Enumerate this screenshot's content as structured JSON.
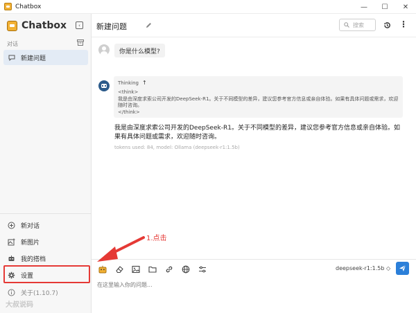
{
  "window": {
    "title": "Chatbox",
    "controls": [
      "—",
      "☐",
      "✕"
    ]
  },
  "sidebar": {
    "brand": "Chatbox",
    "section_label": "对话",
    "conversations": [
      {
        "label": "新建问题"
      }
    ],
    "menu": {
      "new_chat": "新对话",
      "new_image": "新图片",
      "my_partners": "我的搭档",
      "settings": "设置",
      "about": "关于(1.10.7)"
    },
    "watermark": "大叔说码"
  },
  "header": {
    "conversation_title": "新建问题",
    "search_placeholder": "搜索"
  },
  "messages": {
    "user": "你是什么模型?",
    "thinking_label": "Thinking",
    "thinking_text": "<think>\n我是由深度求索公司开发的DeepSeek-R1。关于不同模型的差异，建议您参考官方信息或亲自体验。如果有具体问题或需求，欢迎随时咨询。\n</think>",
    "answer": "我是由深度求索公司开发的DeepSeek-R1。关于不同模型的差异，建议您参考官方信息或亲自体验。如果有具体问题或需求，欢迎随时咨询。",
    "tokens": "tokens used: 84, model: Ollama (deepseek-r1:1.5b)"
  },
  "input": {
    "placeholder": "在这里输入你的问题...",
    "model": "deepseek-r1:1.5b ◇"
  },
  "annotation": {
    "label": "1.点击",
    "color": "#e53935"
  }
}
